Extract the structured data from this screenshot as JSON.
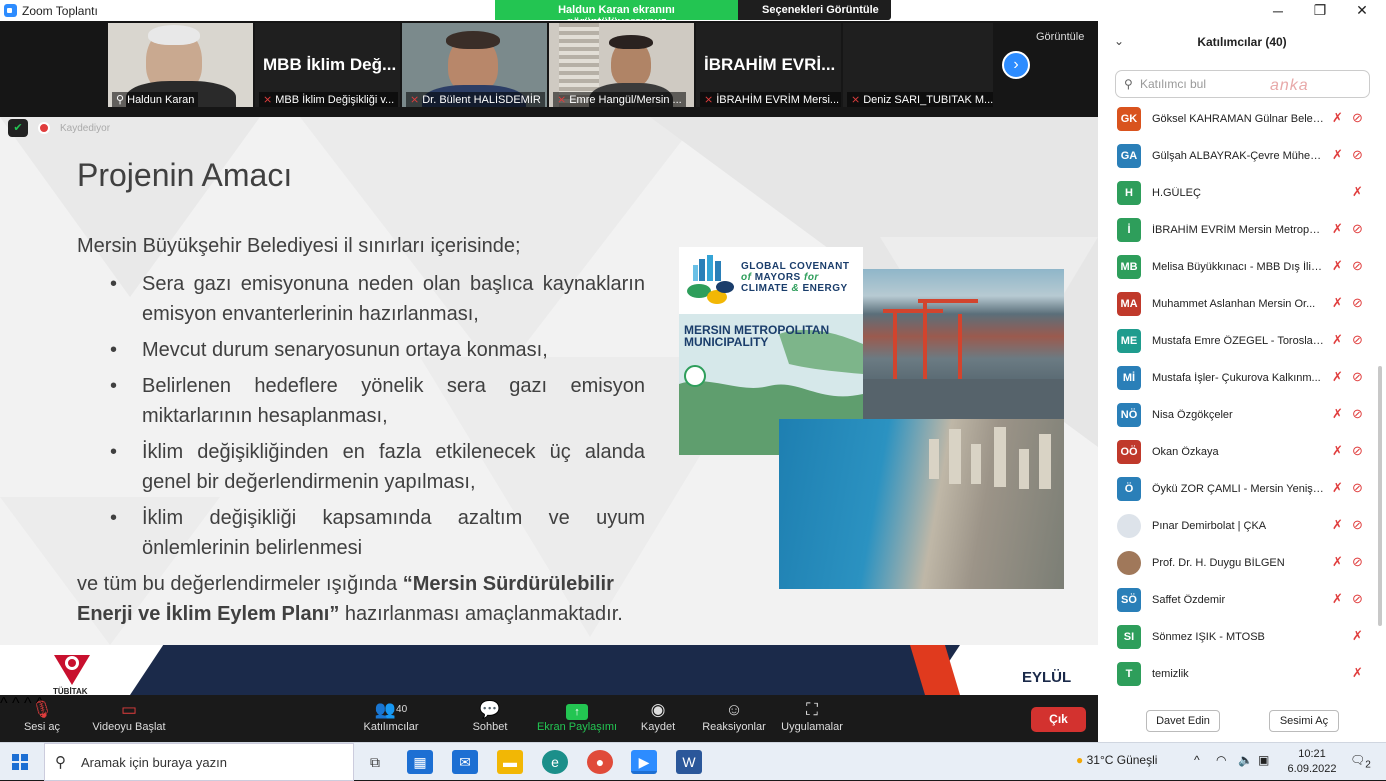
{
  "window": {
    "title": "Zoom Toplantı",
    "min": "─",
    "max": "❐",
    "close": "✕"
  },
  "share_banner": {
    "sharing": "Haldun Karan ekranını görüntülüyorsunuz",
    "options": "Seçenekleri Görüntüle ⌄"
  },
  "video_strip": {
    "tiles": [
      {
        "label": "Haldun Karan",
        "big": ""
      },
      {
        "label": "MBB İklim Değişikliği v...",
        "big": "MBB İklim Değ..."
      },
      {
        "label": "Dr. Bülent HALİSDEMİR",
        "big": ""
      },
      {
        "label": "Emre Hangül/Mersin ...",
        "big": ""
      },
      {
        "label": "İBRAHİM EVRİM Mersi...",
        "big": "İBRAHİM EVRİ..."
      },
      {
        "label": "Deniz SARI_TUBITAK M...",
        "big": ""
      }
    ],
    "view_label": "Görüntüle",
    "next_icon": "›"
  },
  "indicator": {
    "recording": "Kaydediyor"
  },
  "slide": {
    "title": "Projenin Amacı",
    "intro": "Mersin Büyükşehir Belediyesi il sınırları içerisinde;",
    "bullets": [
      "Sera gazı emisyonuna neden olan başlıca kaynakların emisyon envanterlerinin hazırlanması,",
      "Mevcut durum senaryosunun ortaya konması,",
      "Belirlenen hedeflere yönelik sera gazı emisyon miktarlarının hesaplanması,",
      "İklim değişikliğinden en fazla etkilenecek üç alanda genel bir değerlendirmenin yapılması,",
      "İklim değişikliği kapsamında azaltım ve uyum önlemlerinin belirlenmesi"
    ],
    "outro_a": "ve tüm bu değerlendirmeler ışığında ",
    "outro_bold": "“Mersin Sürdürülebilir Enerji ve  İklim Eylem Planı”",
    "outro_b": " hazırlanması amaçlanmaktadır.",
    "gcom_l1": "GLOBAL COVENANT",
    "gcom_l2a": "of",
    "gcom_l2b": " MAYORS ",
    "gcom_l2c": "for",
    "gcom_l3a": "CLIMATE ",
    "gcom_l3b": "&",
    "gcom_l3c": " ENERGY",
    "map_title": "MERSIN METROPOLITAN MUNICIPALITY",
    "footer_text": "EYLÜL",
    "logo_text": "TÜBİTAK"
  },
  "toolbar": {
    "mute": "Sesi aç",
    "video": "Videoyu Başlat",
    "participants": "Katılımcılar",
    "participants_count": "40",
    "chat": "Sohbet",
    "share": "Ekran Paylaşımı",
    "record": "Kaydet",
    "reactions": "Reaksiyonlar",
    "apps": "Uygulamalar",
    "end": "Çık"
  },
  "panel": {
    "title": "Katılımcılar (40)",
    "search_placeholder": "Katılımcı bul",
    "watermark": "anka",
    "participants": [
      {
        "initials": "GK",
        "name": "Göksel KAHRAMAN Gülnar Beled...",
        "color": "#d9531e",
        "video": true
      },
      {
        "initials": "GA",
        "name": "Gülşah ALBAYRAK-Çevre Mühen...",
        "color": "#2a7fb8",
        "video": true
      },
      {
        "initials": "H",
        "name": "H.GÜLEÇ",
        "color": "#2e9e5b",
        "video": false
      },
      {
        "initials": "İ",
        "name": "İBRAHİM EVRİM Mersin Metropo...",
        "color": "#2e9e5b",
        "video": true
      },
      {
        "initials": "MB",
        "name": "Melisa Büyükkınacı - MBB Dış İliş...",
        "color": "#2e9e5b",
        "video": true
      },
      {
        "initials": "MA",
        "name": "Muhammet Aslanhan Mersin Or...",
        "color": "#c0392b",
        "video": true
      },
      {
        "initials": "ME",
        "name": "Mustafa Emre ÖZEGEL - Toroslar ...",
        "color": "#1f9c8e",
        "video": true
      },
      {
        "initials": "Mİ",
        "name": "Mustafa İşler- Çukurova Kalkınm...",
        "color": "#2a7fb8",
        "video": true
      },
      {
        "initials": "NÖ",
        "name": "Nisa Özgökçeler",
        "color": "#2a7fb8",
        "video": true
      },
      {
        "initials": "OÖ",
        "name": "Okan Özkaya",
        "color": "#c0392b",
        "video": true
      },
      {
        "initials": "Ö",
        "name": "Öykü ZOR ÇAMLI - Mersin Yenişe...",
        "color": "#2a7fb8",
        "video": true
      },
      {
        "initials": "",
        "name": "Pınar Demirbolat | ÇKA",
        "color": "#dde3ea",
        "video": true
      },
      {
        "initials": "",
        "name": "Prof. Dr. H. Duygu BİLGEN",
        "color": "#a0785a",
        "video": true
      },
      {
        "initials": "SÖ",
        "name": "Saffet Özdemir",
        "color": "#2a7fb8",
        "video": true
      },
      {
        "initials": "SI",
        "name": "Sönmez IŞIK - MTOSB",
        "color": "#2e9e5b",
        "video": false
      },
      {
        "initials": "T",
        "name": "temizlik",
        "color": "#2e9e5b",
        "video": false
      }
    ],
    "invite": "Davet Edin",
    "unmute": "Sesimi Aç"
  },
  "taskbar": {
    "search": "Aramak için buraya yazın",
    "weather": "31°C  Güneşli",
    "time": "10:21",
    "date": "6.09.2022",
    "notif": "2"
  }
}
